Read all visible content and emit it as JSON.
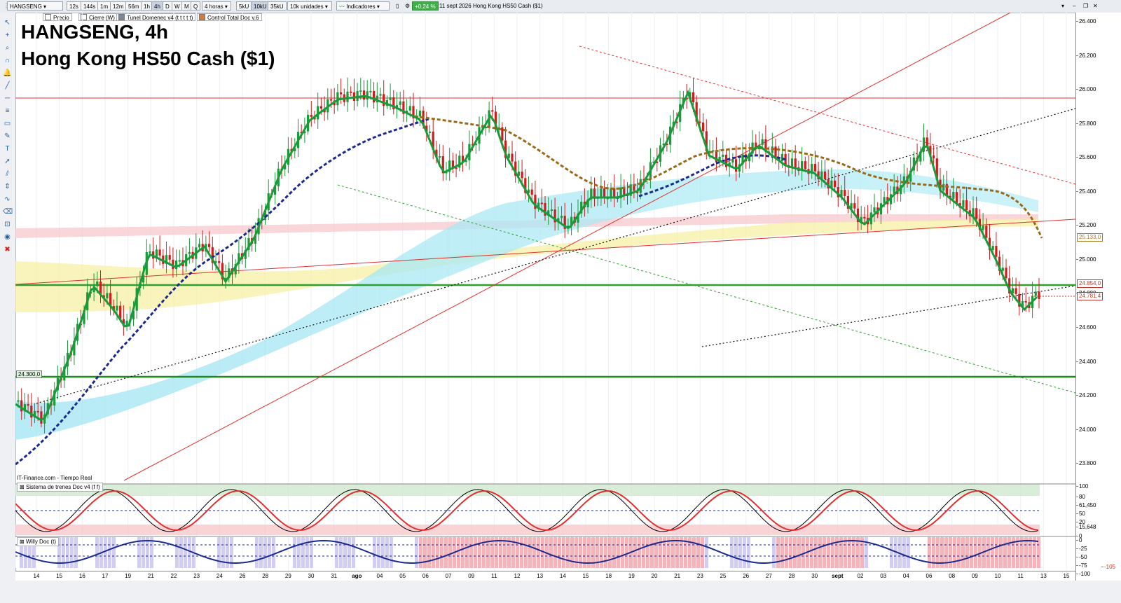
{
  "toolbar": {
    "symbol": "HANGSENG",
    "timeframes": [
      "12s",
      "144s",
      "1m",
      "12m",
      "56m",
      "1h",
      "4h",
      "D",
      "W",
      "M",
      "Q"
    ],
    "active_timeframe": "4h",
    "period": "4 horas",
    "units": [
      "5kU",
      "10kU",
      "35kU"
    ],
    "units_selected": "10k unidades",
    "indicators_label": "Indicadores",
    "change": "+0,24 %",
    "date": "11 sept 2026",
    "instrument": "Hong Kong HS50 Cash ($1)",
    "change_color": "#3fae49"
  },
  "indicator_bar": [
    {
      "label": "Precio"
    },
    {
      "label": "Cierre (W)"
    },
    {
      "label": "Tunel Domenec v4 (t t t t t)"
    },
    {
      "label": "Control Total Doc v.6"
    }
  ],
  "chart_title": {
    "line1": "HANGSENG, 4h",
    "line2": "Hong Kong HS50 Cash ($1)"
  },
  "source_label": "IT-Finance.com - Tiempo Real",
  "price_axis": {
    "labels": [
      "26.400",
      "26.200",
      "26.000",
      "25.800",
      "25.600",
      "25.400",
      "25.200",
      "25.000",
      "24.800",
      "24.600",
      "24.400",
      "24.200",
      "24.000",
      "23.800"
    ],
    "tags": [
      {
        "text": "25.133,0",
        "color": "#b07a1a"
      },
      {
        "text": "24.854,0",
        "color": "#c0392b"
      },
      {
        "text": "24.781,4",
        "color": "#c0392b"
      }
    ],
    "left_tag": "24.300,0"
  },
  "oscillator1": {
    "title": "Sistema de trenes Doc v4 (f f)",
    "labels": [
      "100",
      "80",
      "61,450",
      "50",
      "20",
      "15,648",
      "0"
    ]
  },
  "oscillator2": {
    "title": "Willy Doc (t)",
    "labels": [
      "0",
      "-25",
      "-50",
      "-75",
      "-100",
      "-105"
    ]
  },
  "date_axis": {
    "labels": [
      {
        "text": "14"
      },
      {
        "text": "15"
      },
      {
        "text": "16"
      },
      {
        "text": "17"
      },
      {
        "text": "19"
      },
      {
        "text": "21"
      },
      {
        "text": "22"
      },
      {
        "text": "23"
      },
      {
        "text": "24"
      },
      {
        "text": "26"
      },
      {
        "text": "28"
      },
      {
        "text": "29"
      },
      {
        "text": "30"
      },
      {
        "text": "31"
      },
      {
        "text": "ago",
        "bold": true
      },
      {
        "text": "04"
      },
      {
        "text": "05"
      },
      {
        "text": "06"
      },
      {
        "text": "07"
      },
      {
        "text": "09"
      },
      {
        "text": "11"
      },
      {
        "text": "12"
      },
      {
        "text": "13"
      },
      {
        "text": "14"
      },
      {
        "text": "15"
      },
      {
        "text": "18"
      },
      {
        "text": "19"
      },
      {
        "text": "20"
      },
      {
        "text": "21"
      },
      {
        "text": "23"
      },
      {
        "text": "25"
      },
      {
        "text": "26"
      },
      {
        "text": "27"
      },
      {
        "text": "28"
      },
      {
        "text": "30"
      },
      {
        "text": "sept",
        "bold": true
      },
      {
        "text": "02"
      },
      {
        "text": "03"
      },
      {
        "text": "04"
      },
      {
        "text": "06"
      },
      {
        "text": "08"
      },
      {
        "text": "09"
      },
      {
        "text": "10"
      },
      {
        "text": "11"
      },
      {
        "text": "13"
      },
      {
        "text": "15"
      }
    ]
  },
  "colors": {
    "bull": "#1a9a3a",
    "bear": "#d01c1c",
    "navy": "#1b2a8c",
    "hline_green": "#2ea02e",
    "resistance": "#e03030"
  },
  "left_tools": [
    "cursor-icon",
    "crosshair-icon",
    "zoom-icon",
    "magnet-icon",
    "alert-icon",
    "line-icon",
    "hline-icon",
    "fib-icon",
    "rect-icon",
    "pencil-icon",
    "text-icon",
    "arrow-icon",
    "channel-icon",
    "measure-icon",
    "brush-icon",
    "eraser-icon",
    "lock-icon",
    "eye-icon",
    "trash-icon"
  ]
}
